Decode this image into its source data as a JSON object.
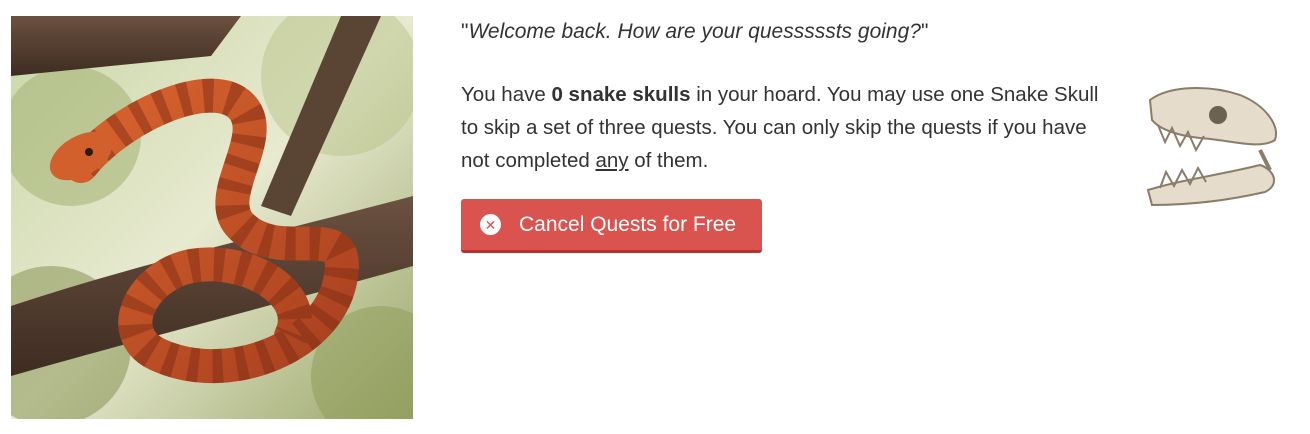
{
  "quote": {
    "open_mark": "\"",
    "text": "Welcome back. How are your quesssssts going?",
    "close_mark": "\""
  },
  "info": {
    "part1": "You have ",
    "count_bold": "0 snake skulls",
    "part2": " in your hoard. You may use one Snake Skull to skip a set of three quests. You can only skip the quests if you have not completed ",
    "underlined": "any",
    "part3": " of them."
  },
  "cancel_button": {
    "label": "Cancel Quests for Free",
    "icon": "x-circle-icon",
    "color": "#d9534f"
  },
  "icons": {
    "portrait": "snake-portrait",
    "skull": "snake-skull-icon"
  }
}
